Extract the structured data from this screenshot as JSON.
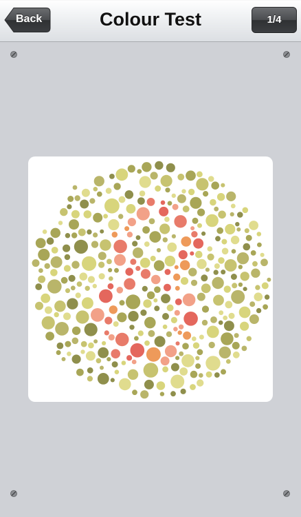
{
  "nav": {
    "title": "Colour Test",
    "back_label": "Back",
    "page_indicator": "1/4"
  },
  "plate": {
    "description_icon": "ishihara-plate",
    "colors": {
      "background_dots": [
        "#a8a657",
        "#c7c370",
        "#d8d57c",
        "#8f8f4c",
        "#b9b56a",
        "#e0dc8e"
      ],
      "figure_dots": [
        "#e87b6a",
        "#f2a188",
        "#ee9a5a",
        "#e4675d"
      ]
    }
  },
  "colors": {
    "background": "#cfd1d6",
    "card": "#ffffff"
  }
}
